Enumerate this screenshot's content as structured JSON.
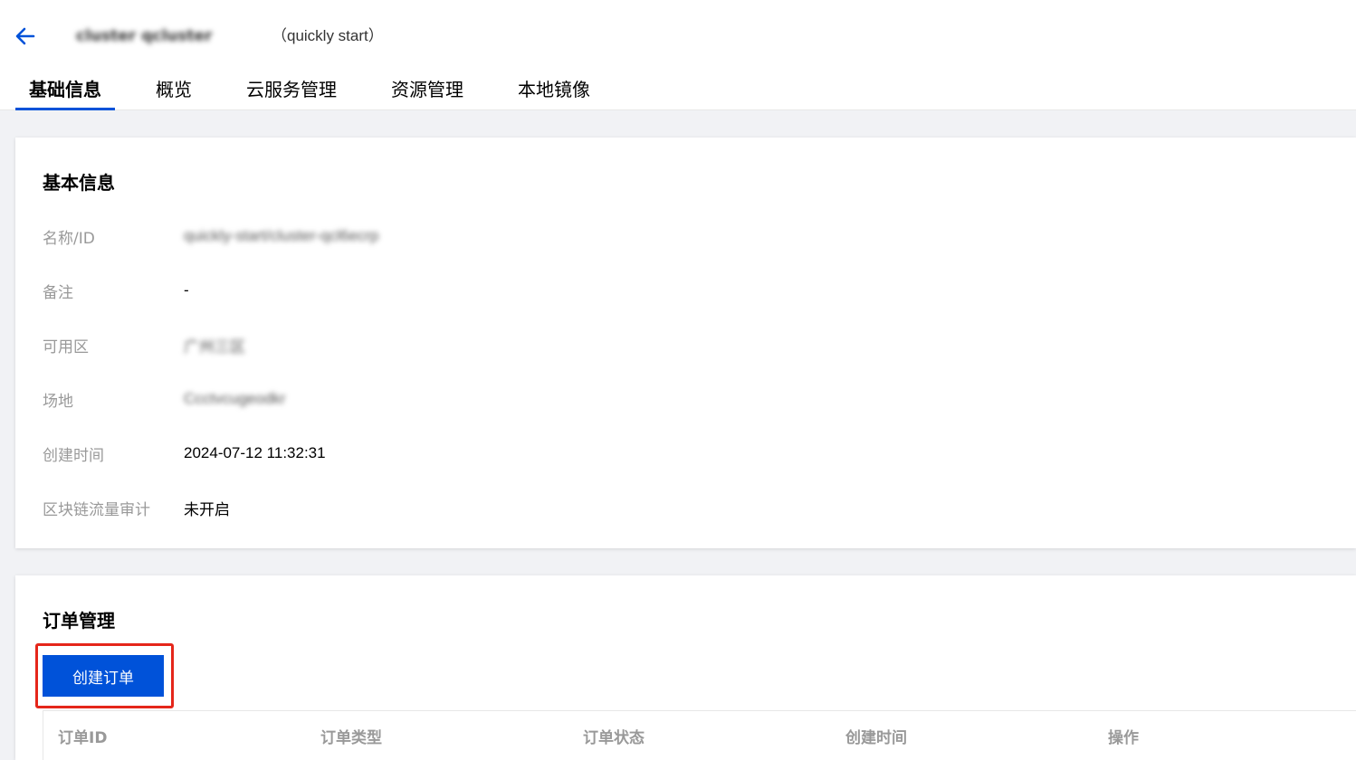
{
  "header": {
    "title_obscured": "cluster qcluster",
    "title_suffix": "（quickly start）"
  },
  "tabs": [
    {
      "label": "基础信息",
      "active": true
    },
    {
      "label": "概览",
      "active": false
    },
    {
      "label": "云服务管理",
      "active": false
    },
    {
      "label": "资源管理",
      "active": false
    },
    {
      "label": "本地镜像",
      "active": false
    }
  ],
  "basic_info": {
    "title": "基本信息",
    "rows": [
      {
        "label": "名称/ID",
        "value": "quickly-start/cluster-qcl6ecrp",
        "blurred": true
      },
      {
        "label": "备注",
        "value": "-",
        "blurred": false
      },
      {
        "label": "可用区",
        "value": "广州三区",
        "blurred": true
      },
      {
        "label": "场地",
        "value": "Ccctvcugeodkr",
        "blurred": true
      },
      {
        "label": "创建时间",
        "value": "2024-07-12 11:32:31",
        "blurred": false
      },
      {
        "label": "区块链流量审计",
        "value": "未开启",
        "blurred": false
      }
    ]
  },
  "orders": {
    "title": "订单管理",
    "create_button": "创建订单",
    "columns": [
      "订单ID",
      "订单类型",
      "订单状态",
      "创建时间",
      "操作"
    ]
  },
  "colors": {
    "primary": "#0052d9",
    "highlight": "#e5261a"
  }
}
